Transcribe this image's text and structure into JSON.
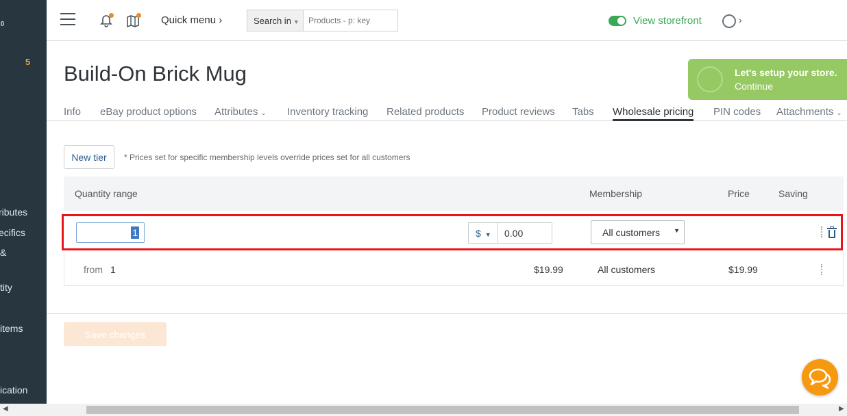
{
  "sidebar": {
    "version": ".0",
    "badge": "5",
    "items": [
      "ributes",
      "ecifics",
      "&",
      "tity",
      "items",
      "ication"
    ]
  },
  "header": {
    "quick_menu": "Quick menu ›",
    "search_scope": "Search in",
    "search_placeholder": "Products - p: key",
    "storefront_label": "View storefront",
    "user_chevron": "›"
  },
  "page": {
    "title": "Build-On Brick Mug"
  },
  "setup_banner": {
    "line1": "Let's setup your store.",
    "line2": "Continue"
  },
  "tabs": [
    {
      "label": "Info"
    },
    {
      "label": "eBay product options"
    },
    {
      "label": "Attributes"
    },
    {
      "label": "Inventory tracking"
    },
    {
      "label": "Related products"
    },
    {
      "label": "Product reviews"
    },
    {
      "label": "Tabs"
    },
    {
      "label": "Wholesale pricing"
    },
    {
      "label": "PIN codes"
    },
    {
      "label": "Attachments"
    }
  ],
  "wholesale": {
    "new_tier_label": "New tier",
    "note": "* Prices set for specific membership levels override prices set for all customers",
    "columns": {
      "quantity_range": "Quantity range",
      "membership": "Membership",
      "price": "Price",
      "saving": "Saving"
    },
    "edit_row": {
      "quantity_value": "1",
      "currency": "$",
      "price_value": "0.00",
      "membership": "All customers"
    },
    "rows": [
      {
        "from_label": "from",
        "from_value": "1",
        "base_price": "$19.99",
        "membership": "All customers",
        "price": "$19.99"
      }
    ],
    "save_label": "Save changes"
  },
  "colors": {
    "sidebar_bg": "#27363f",
    "accent_green": "#39a955",
    "link_blue": "#2a5c92",
    "highlight_red": "#e8141a",
    "chat_orange": "#f6990e"
  }
}
